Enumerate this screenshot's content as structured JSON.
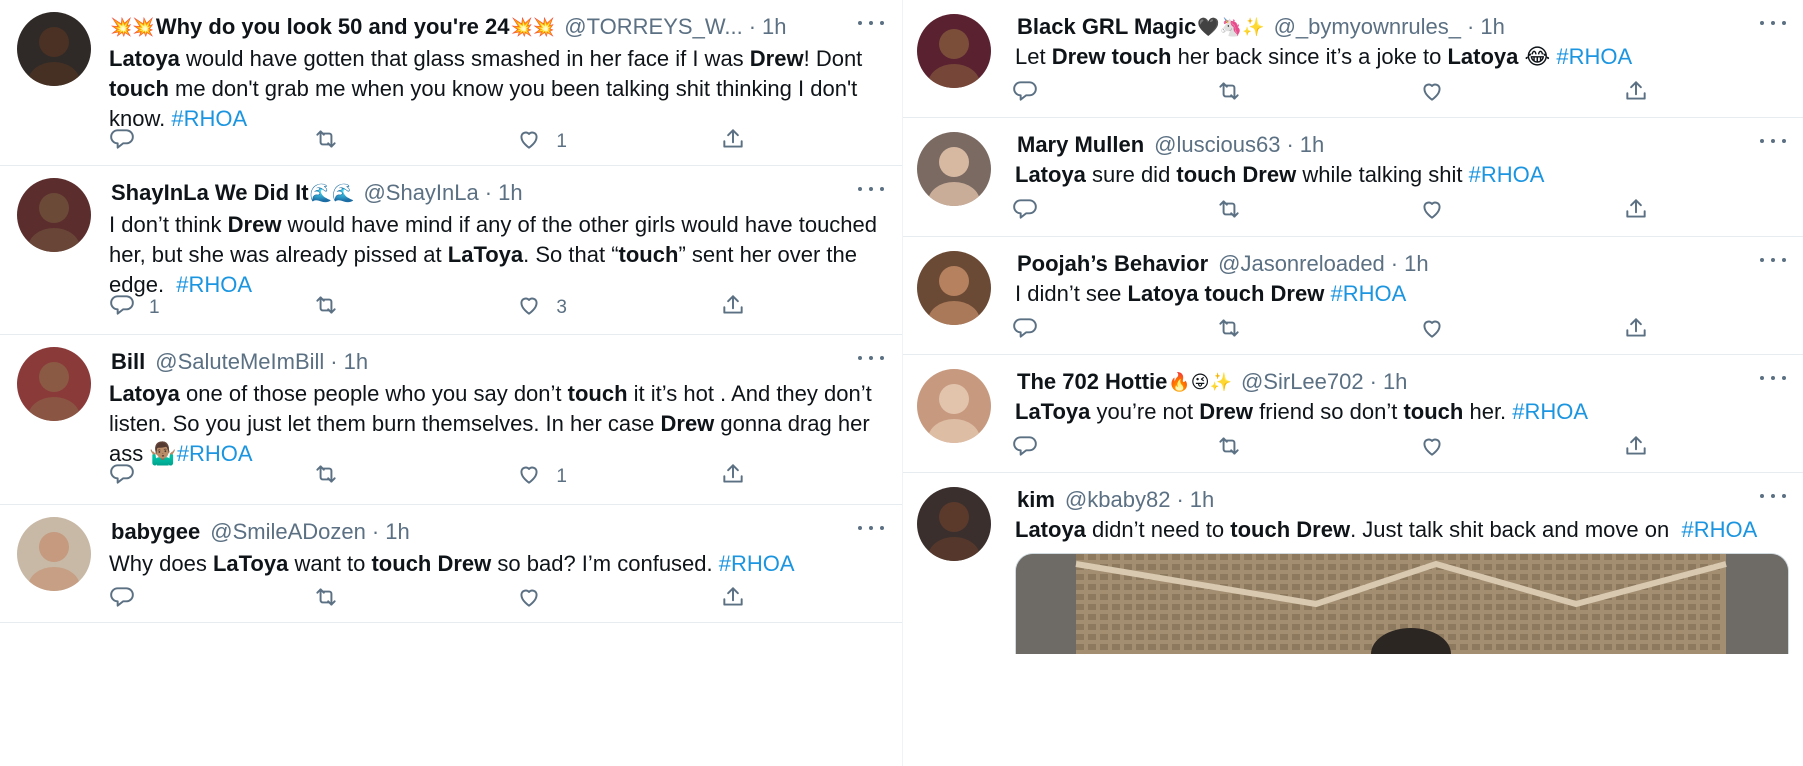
{
  "left_tweets": [
    {
      "name": "Why do you look 50 and you're 24",
      "name_prefix_emoji": "💥💥",
      "name_suffix_emoji": "💥💥",
      "handle": "@TORREYS_W...",
      "time": "1h",
      "text": "<b>Latoya</b> would have gotten that glass smashed in her face if I was <b>Drew</b>! Dont <b>touch</b> me don't grab me when you know you been talking shit thinking I don't know. <span class=\"tag\">#RHOA</span>",
      "replies": "",
      "retweets": "",
      "likes": "1"
    },
    {
      "name": "ShayInLa We Did It",
      "name_prefix_emoji": "",
      "name_suffix_emoji": "🌊🌊",
      "handle": "@ShayInLa",
      "time": "1h",
      "text": "I don’t think <b>Drew</b> would have mind if any of the other girls would have touched her, but she was already pissed at <b>LaToya</b>. So that “<b>touch</b>” sent her over the edge. &nbsp;<span class=\"tag\">#RHOA</span>",
      "replies": "1",
      "retweets": "",
      "likes": "3"
    },
    {
      "name": "Bill",
      "name_prefix_emoji": "",
      "name_suffix_emoji": "",
      "handle": "@SaluteMeImBill",
      "time": "1h",
      "text": "<b>Latoya</b> one of those people who you say don’t <b>touch</b> it it’s hot . And they don’t listen. So you just let them burn themselves. In her case <b>Drew</b> gonna drag her ass 🤷🏽‍♂️<span class=\"tag\">#RHOA</span>",
      "replies": "",
      "retweets": "",
      "likes": "1"
    },
    {
      "name": "babygee",
      "name_prefix_emoji": "",
      "name_suffix_emoji": "",
      "handle": "@SmileADozen",
      "time": "1h",
      "text": "Why does <b>LaToya</b> want to <b>touch Drew</b> so bad? I’m confused. <span class=\"tag\">#RHOA</span>",
      "replies": "",
      "retweets": "",
      "likes": ""
    }
  ],
  "right_tweets": [
    {
      "name": "Black GRL Magic",
      "name_prefix_emoji": "",
      "name_suffix_emoji": "🖤🦄✨",
      "handle": "@_bymyownrules_",
      "time": "1h",
      "text": "Let <b>Drew touch</b> her back since it’s a joke to <b>Latoya</b> 😂 <span class=\"tag\">#RHOA</span>",
      "replies": "",
      "retweets": "",
      "likes": ""
    },
    {
      "name": "Mary Mullen",
      "name_prefix_emoji": "",
      "name_suffix_emoji": "",
      "handle": "@luscious63",
      "time": "1h",
      "text": "<b>Latoya</b> sure did <b>touch Drew</b> while talking shit <span class=\"tag\">#RHOA</span>",
      "replies": "",
      "retweets": "",
      "likes": ""
    },
    {
      "name": "Poojah’s Behavior",
      "name_prefix_emoji": "",
      "name_suffix_emoji": "",
      "handle": "@Jasonreloaded",
      "time": "1h",
      "text": "I didn’t see <b>Latoya touch Drew</b> <span class=\"tag\">#RHOA</span>",
      "replies": "",
      "retweets": "",
      "likes": ""
    },
    {
      "name": "The 702 Hottie",
      "name_prefix_emoji": "",
      "name_suffix_emoji": "🔥😜✨",
      "handle": "@SirLee702",
      "time": "1h",
      "text": "<b>LaToya</b> you’re not <b>Drew</b> friend so don’t <b>touch</b> her. <span class=\"tag\">#RHOA</span>",
      "replies": "",
      "retweets": "",
      "likes": ""
    },
    {
      "name": "kim",
      "name_prefix_emoji": "",
      "name_suffix_emoji": "",
      "handle": "@kbaby82",
      "time": "1h",
      "text": "<b>Latoya</b> didn’t need to <b>touch Drew</b>. Just talk shit back and move on &nbsp;<span class=\"tag\">#RHOA</span>",
      "replies": "",
      "retweets": "",
      "likes": ""
    }
  ],
  "icons": {
    "reply": "reply-icon",
    "retweet": "retweet-icon",
    "like": "heart-icon",
    "share": "share-icon",
    "more": "more-icon"
  },
  "colors": {
    "hashtag": "#1b95e0",
    "secondary_text": "#5b7083",
    "divider": "#e6ecf0"
  }
}
